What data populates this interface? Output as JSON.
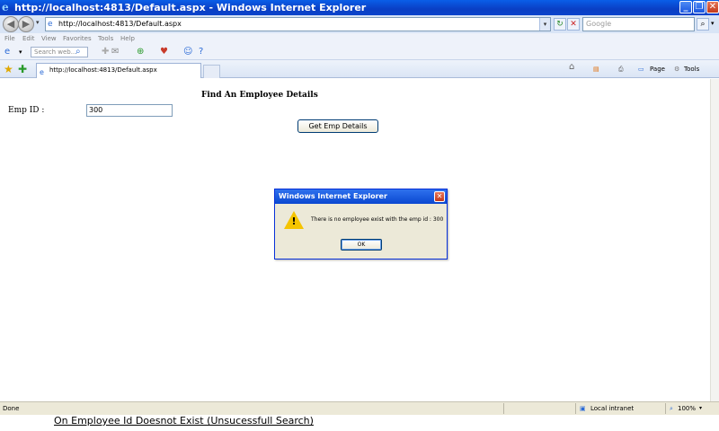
{
  "window": {
    "title": "http://localhost:4813/Default.aspx - Windows Internet Explorer"
  },
  "addressbar": {
    "url": "http://localhost:4813/Default.aspx",
    "search_placeholder": "Google"
  },
  "menu": {
    "items": [
      "File",
      "Edit",
      "View",
      "Favorites",
      "Tools",
      "Help"
    ]
  },
  "toolbar": {
    "websearch_placeholder": "Search web..."
  },
  "tabs": [
    {
      "label": "http://localhost:4813/Default.aspx"
    }
  ],
  "commandbar": {
    "page_label": "Page",
    "tools_label": "Tools"
  },
  "page": {
    "heading": "Find An Employee Details",
    "emp_label": "Emp ID :",
    "emp_value": "300",
    "button_label": "Get Emp Details"
  },
  "dialog": {
    "title": "Windows Internet Explorer",
    "message": "There is no employee exist with the emp id : 300",
    "ok_label": "OK"
  },
  "statusbar": {
    "status": "Done",
    "zone": "Local intranet",
    "zoom": "100%"
  },
  "caption": "On Employee Id Doesnot Exist (Unsucessfull Search)"
}
